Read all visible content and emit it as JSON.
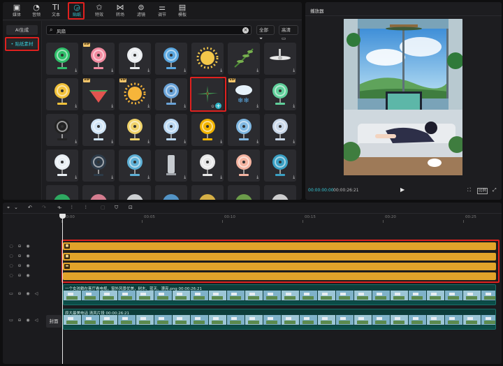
{
  "top_tabs": [
    {
      "label": "媒体",
      "icon": "media-icon"
    },
    {
      "label": "音频",
      "icon": "audio-icon"
    },
    {
      "label": "文本",
      "icon": "text-icon",
      "glyph": "TI"
    },
    {
      "label": "贴纸",
      "icon": "sticker-icon",
      "active": true
    },
    {
      "label": "特效",
      "icon": "effects-icon"
    },
    {
      "label": "转场",
      "icon": "transition-icon"
    },
    {
      "label": "滤镜",
      "icon": "filter-icon"
    },
    {
      "label": "调节",
      "icon": "adjust-icon"
    },
    {
      "label": "模板",
      "icon": "template-icon"
    }
  ],
  "left_sub": {
    "ai_label": "AI生成",
    "sticker_label": "• 贴纸素材"
  },
  "search": {
    "value": "风扇",
    "filter_all": "全部",
    "filter_hd": "高清"
  },
  "sticker_grid": {
    "vip_label": "VIP",
    "download_glyph": "⤓",
    "items": [
      {
        "kind": "fan-green",
        "vip": false
      },
      {
        "kind": "fan-pink",
        "vip": true
      },
      {
        "kind": "fan-white",
        "vip": false
      },
      {
        "kind": "fan-blue",
        "vip": false
      },
      {
        "kind": "sun-smile",
        "vip": false
      },
      {
        "kind": "leaves",
        "vip": false
      },
      {
        "kind": "ceiling-fan",
        "vip": false
      },
      {
        "kind": "fan-yellow",
        "vip": false
      },
      {
        "kind": "watermelon",
        "vip": true
      },
      {
        "kind": "sun",
        "vip": true
      },
      {
        "kind": "fan-blue2",
        "vip": false
      },
      {
        "kind": "ceiling-fan-green",
        "vip": false,
        "selected": true
      },
      {
        "kind": "snowflake",
        "vip": true
      },
      {
        "kind": "coconut",
        "vip": false
      },
      {
        "kind": "fan-black",
        "vip": false
      },
      {
        "kind": "propeller",
        "vip": false
      },
      {
        "kind": "stars",
        "vip": false
      },
      {
        "kind": "fans-row",
        "vip": false
      },
      {
        "kind": "fan-yellow2",
        "vip": false
      },
      {
        "kind": "fan-blue3",
        "vip": false
      },
      {
        "kind": "fan-light",
        "vip": false
      },
      {
        "kind": "fan-stand",
        "vip": false
      },
      {
        "kind": "fan-dark",
        "vip": false
      },
      {
        "kind": "fan-desk",
        "vip": false
      },
      {
        "kind": "tower-fan",
        "vip": false
      },
      {
        "kind": "fan-propeller",
        "vip": false
      },
      {
        "kind": "fan-retro",
        "vip": false
      },
      {
        "kind": "fan-tall",
        "vip": false
      },
      {
        "kind": "partial-1",
        "vip": false
      },
      {
        "kind": "partial-2",
        "vip": false
      },
      {
        "kind": "partial-3",
        "vip": false
      },
      {
        "kind": "partial-4",
        "vip": false
      },
      {
        "kind": "partial-5",
        "vip": false
      },
      {
        "kind": "partial-6",
        "vip": false
      },
      {
        "kind": "partial-7",
        "vip": false
      }
    ]
  },
  "player": {
    "title": "播放器",
    "current_time": "00:00:00:00",
    "total_time": "00:00:26:21",
    "ratio_label": "比例"
  },
  "timeline": {
    "ruler_ticks": [
      "00:00",
      "00:05",
      "00:10",
      "00:15",
      "00:20",
      "00:25"
    ],
    "video_tracks": [
      {
        "title": "一个女孩躺在客厅看电视，窗外风景优美，树木、蓝天、漂亮.png  00:00:26:21"
      },
      {
        "title": "原大最美电话 清风片段  00:00:26:21"
      }
    ],
    "cover_label": "封面"
  },
  "colors": {
    "accent": "#37c8d6",
    "sticker_clip": "#e1a32a",
    "highlight": "#e0211f",
    "video_track": "#0d3d3a"
  }
}
